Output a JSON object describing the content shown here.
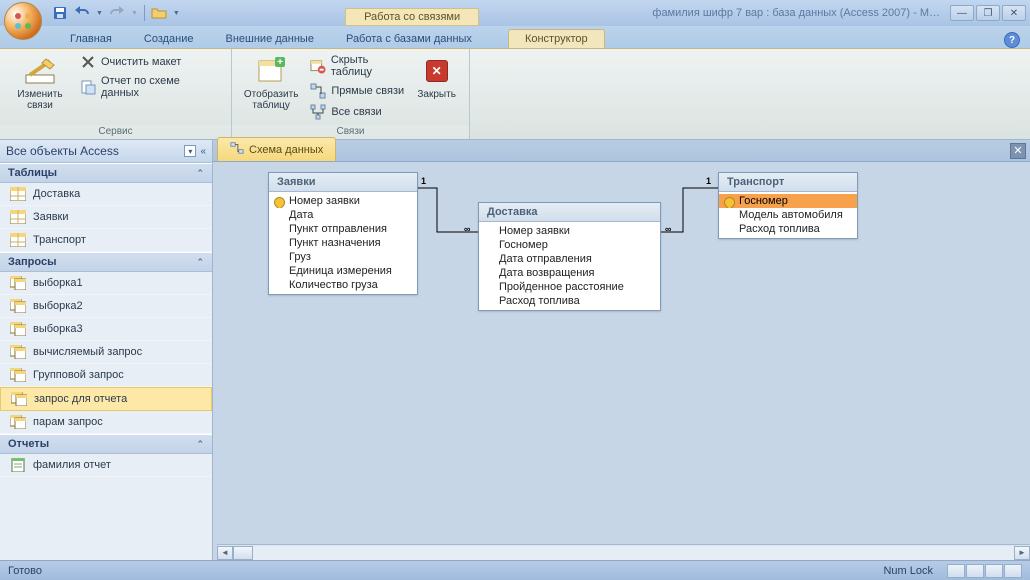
{
  "titlebar": {
    "context_label": "Работа со связями",
    "app_title": "фамилия шифр 7 вар : база данных (Access 2007) - M…"
  },
  "tabs": {
    "home": "Главная",
    "create": "Создание",
    "external": "Внешние данные",
    "dbtools": "Работа с базами данных",
    "designer": "Конструктор"
  },
  "ribbon": {
    "group_service": "Сервис",
    "group_links": "Связи",
    "edit_links": "Изменить связи",
    "clear_layout": "Очистить макет",
    "schema_report": "Отчет по схеме данных",
    "show_table": "Отобразить таблицу",
    "hide_table": "Скрыть таблицу",
    "direct_links": "Прямые связи",
    "all_links": "Все связи",
    "close": "Закрыть"
  },
  "nav": {
    "header": "Все объекты Access",
    "section_tables": "Таблицы",
    "section_queries": "Запросы",
    "section_reports": "Отчеты",
    "tables": [
      "Доставка",
      "Заявки",
      "Транспорт"
    ],
    "queries": [
      "выборка1",
      "выборка2",
      "выборка3",
      "вычисляемый запрос",
      "Групповой запрос",
      "запрос для отчета",
      "парам запрос"
    ],
    "reports": [
      "фамилия отчет"
    ],
    "selected_query_index": 5
  },
  "doc_tab": "Схема данных",
  "tables_diagram": {
    "zayavki": {
      "title": "Заявки",
      "fields": [
        "Номер заявки",
        "Дата",
        "Пункт отправления",
        "Пункт назначения",
        "Груз",
        "Единица измерения",
        "Количество груза"
      ]
    },
    "dostavka": {
      "title": "Доставка",
      "fields": [
        "Номер заявки",
        "Госномер",
        "Дата отправления",
        "Дата возвращения",
        "Пройденное расстояние",
        "Расход топлива"
      ]
    },
    "transport": {
      "title": "Транспорт",
      "fields": [
        "Госномер",
        "Модель автомобиля",
        "Расход топлива"
      ]
    }
  },
  "rel_labels": {
    "one": "1",
    "many": "∞"
  },
  "status": {
    "ready": "Готово",
    "numlock": "Num Lock"
  }
}
